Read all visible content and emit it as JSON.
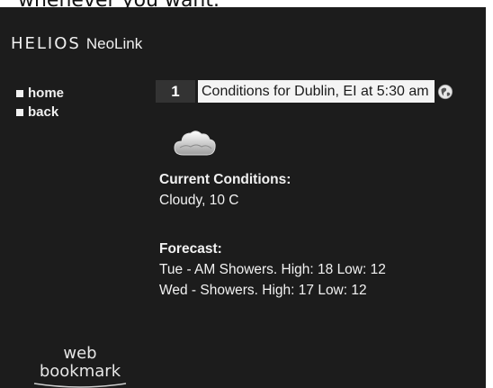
{
  "caption": {
    "text": "whenever you want."
  },
  "header": {
    "logo_text": "HELIOS",
    "product": "NeoLink"
  },
  "nav": {
    "items": [
      {
        "label": "home"
      },
      {
        "label": "back"
      }
    ]
  },
  "titlebar": {
    "page_number": "1",
    "title": "Conditions for Dublin, EI at 5:30 am",
    "icon": "globe-icon"
  },
  "weather": {
    "icon": "cloud-icon",
    "current_heading": "Current Conditions:",
    "current_value": "Cloudy, 10 C",
    "forecast_heading": "Forecast:",
    "forecast": [
      "Tue - AM Showers. High: 18 Low: 12",
      "Wed - Showers. High: 17 Low: 12"
    ]
  },
  "bookmark": {
    "line1": "web",
    "line2": "bookmark"
  },
  "colors": {
    "screen_bg": "#1c1c1c",
    "text": "#f2f2f2",
    "title_field_bg": "#f4f4f4",
    "page_num_bg": "#333333"
  }
}
